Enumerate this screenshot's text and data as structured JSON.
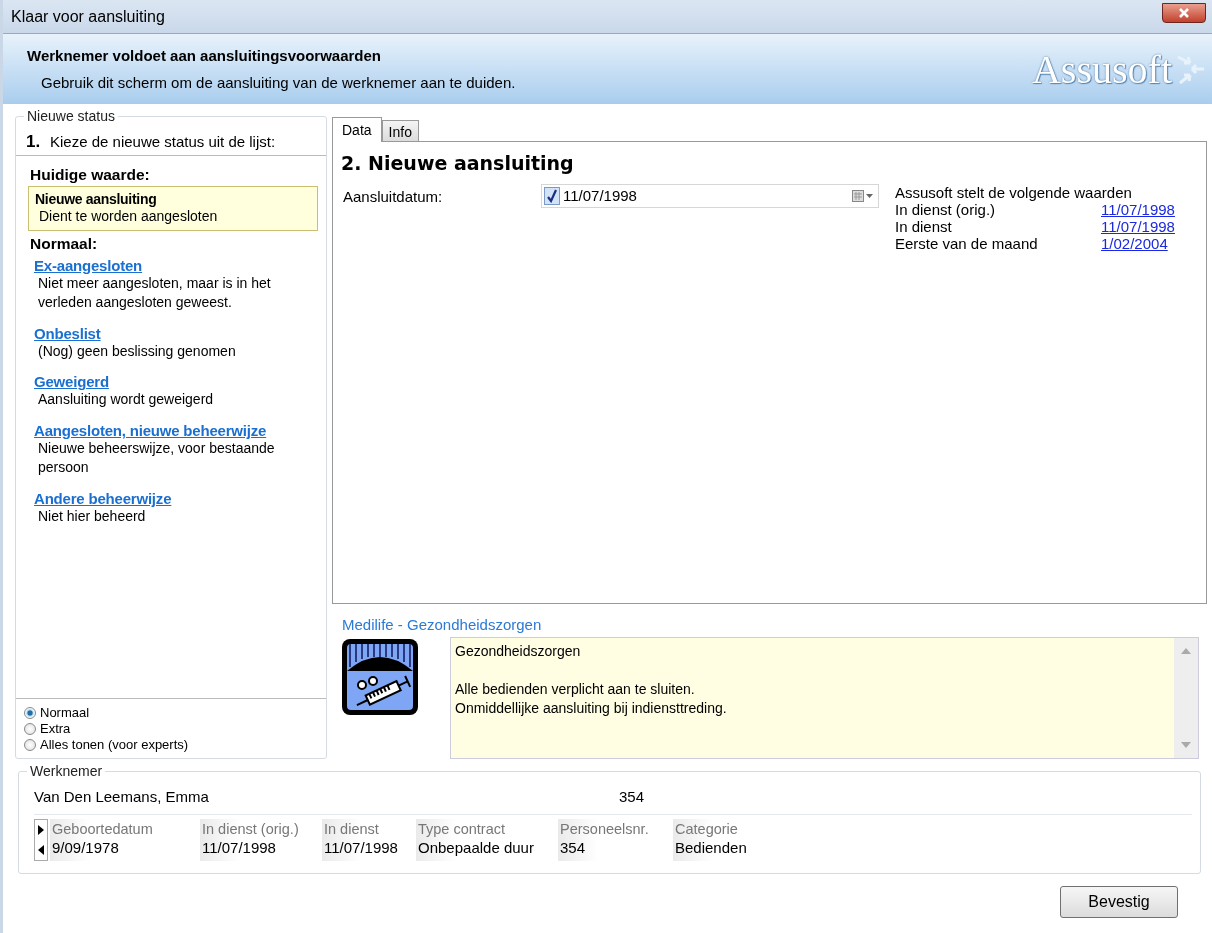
{
  "window": {
    "title": "Klaar voor aansluiting"
  },
  "header": {
    "title": "Werknemer voldoet aan aansluitingsvoorwaarden",
    "subtitle": "Gebruik dit scherm om de aansluiting van de werknemer aan te duiden.",
    "logo": "Assusoft"
  },
  "status_panel": {
    "legend": "Nieuwe status",
    "step": "1.",
    "instruction": "Kieze de nieuwe status uit de lijst:",
    "current_heading": "Huidige waarde:",
    "current": {
      "title": "Nieuwe aansluiting",
      "description": "Dient te worden aangesloten"
    },
    "group_heading": "Normaal:",
    "options": [
      {
        "title": "Ex-aangesloten",
        "description": "Niet meer aangesloten, maar is in het verleden aangesloten geweest."
      },
      {
        "title": "Onbeslist",
        "description": "(Nog) geen beslissing genomen"
      },
      {
        "title": "Geweigerd",
        "description": "Aansluiting wordt geweigerd"
      },
      {
        "title": "Aangesloten, nieuwe beheerwijze",
        "description": "Nieuwe beheerswijze, voor bestaande persoon"
      },
      {
        "title": "Andere beheerwijze",
        "description": "Niet hier beheerd"
      }
    ],
    "modes": [
      {
        "label": "Normaal",
        "selected": true
      },
      {
        "label": "Extra",
        "selected": false
      },
      {
        "label": "Alles tonen (voor experts)",
        "selected": false
      }
    ]
  },
  "tabs": [
    {
      "label": "Data",
      "selected": true
    },
    {
      "label": "Info",
      "selected": false
    }
  ],
  "data_panel": {
    "heading": "2. Nieuwe aansluiting",
    "date_label": "Aansluitdatum:",
    "date_checked": true,
    "date_value": "11/07/1998",
    "suggest_heading": "Assusoft stelt de volgende waarden",
    "suggestions": [
      {
        "label": "In dienst (orig.)",
        "value": "11/07/1998"
      },
      {
        "label": "In dienst",
        "value": "11/07/1998"
      },
      {
        "label": "Eerste van de maand",
        "value": "1/02/2004"
      }
    ]
  },
  "plan": {
    "title": "Medilife - Gezondheidszorgen",
    "text": "Gezondheidszorgen\n\nAlle bedienden verplicht aan te sluiten.\nOnmiddellijke aansluiting bij indiensttreding."
  },
  "employee": {
    "legend": "Werknemer",
    "name": "Van Den Leemans, Emma",
    "number": "354",
    "columns": [
      "Geboortedatum",
      "In dienst (orig.)",
      "In dienst",
      "Type contract",
      "Personeelsnr.",
      "Categorie"
    ],
    "row": [
      "9/09/1978",
      "11/07/1998",
      "11/07/1998",
      "Onbepaalde duur",
      "354",
      "Bedienden"
    ]
  },
  "buttons": [
    "Bevestig"
  ]
}
